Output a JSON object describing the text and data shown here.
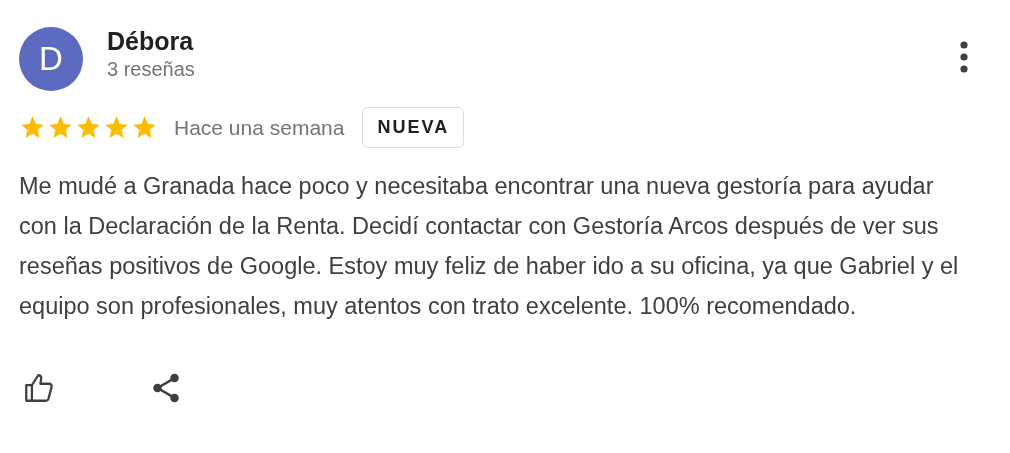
{
  "review": {
    "avatar_letter": "D",
    "author": "Débora",
    "review_count": "3 reseñas",
    "stars": 5,
    "time": "Hace una semana",
    "badge": "NUEVA",
    "text": "Me mudé a Granada hace poco y necesitaba encontrar una nueva gestoría para ayudar con la Declaración de la Renta. Decidí contactar con Gestoría Arcos después de ver sus reseñas positivos de Google. Estoy muy feliz de haber ido a su oficina, ya que Gabriel y el equipo son profesionales, muy atentos con trato excelente. 100% recomendado."
  }
}
